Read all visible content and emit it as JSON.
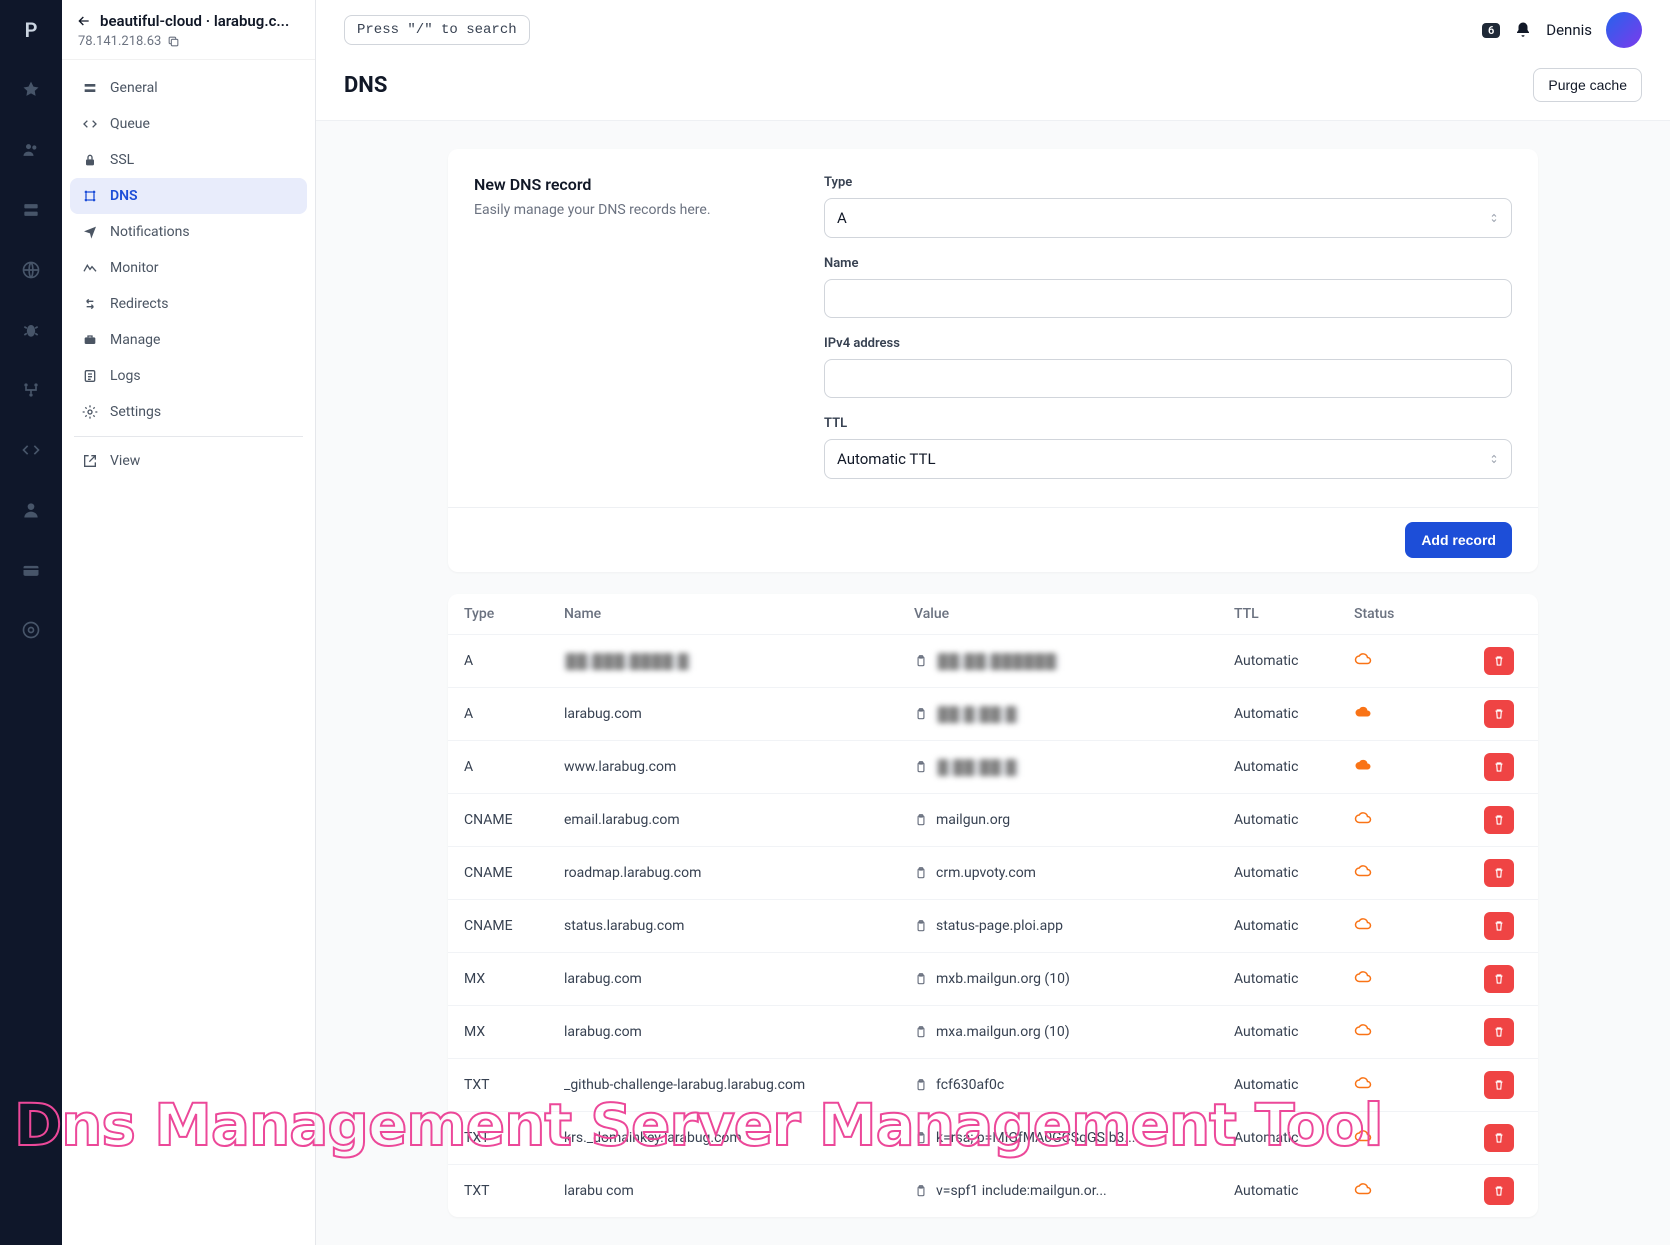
{
  "breadcrumb": "beautiful-cloud · larabug.c...",
  "server_ip": "78.141.218.63",
  "search_hint": "Press \"/\" to search",
  "notifications_count": "6",
  "username": "Dennis",
  "page_title": "DNS",
  "purge_cache": "Purge cache",
  "nav": [
    "General",
    "Queue",
    "SSL",
    "DNS",
    "Notifications",
    "Monitor",
    "Redirects",
    "Manage",
    "Logs",
    "Settings",
    "View"
  ],
  "form": {
    "title": "New DNS record",
    "subtitle": "Easily manage your DNS records here.",
    "labels": {
      "type": "Type",
      "name": "Name",
      "ipv4": "IPv4 address",
      "ttl": "TTL"
    },
    "type_value": "A",
    "ttl_value": "Automatic TTL",
    "submit": "Add record"
  },
  "table": {
    "headers": {
      "type": "Type",
      "name": "Name",
      "value": "Value",
      "ttl": "TTL",
      "status": "Status"
    },
    "rows": [
      {
        "type": "A",
        "name": "██.███.████ █",
        "name_blur": true,
        "value": "██.██.██████",
        "value_blur": true,
        "ttl": "Automatic",
        "cloud": "outline"
      },
      {
        "type": "A",
        "name": "larabug.com",
        "value": "██ █  ██  █",
        "value_blur": true,
        "ttl": "Automatic",
        "cloud": "filled"
      },
      {
        "type": "A",
        "name": "www.larabug.com",
        "value": "█  ██  ██ █",
        "value_blur": true,
        "ttl": "Automatic",
        "cloud": "filled"
      },
      {
        "type": "CNAME",
        "name": "email.larabug.com",
        "value": "mailgun.org",
        "ttl": "Automatic",
        "cloud": "outline"
      },
      {
        "type": "CNAME",
        "name": "roadmap.larabug.com",
        "value": "crm.upvoty.com",
        "ttl": "Automatic",
        "cloud": "outline"
      },
      {
        "type": "CNAME",
        "name": "status.larabug.com",
        "value": "status-page.ploi.app",
        "ttl": "Automatic",
        "cloud": "outline"
      },
      {
        "type": "MX",
        "name": "larabug.com",
        "value": "mxb.mailgun.org (10)",
        "ttl": "Automatic",
        "cloud": "outline"
      },
      {
        "type": "MX",
        "name": "larabug.com",
        "value": "mxa.mailgun.org (10)",
        "ttl": "Automatic",
        "cloud": "outline"
      },
      {
        "type": "TXT",
        "name": "_github-challenge-larabug.larabug.com",
        "value": "fcf630af0c",
        "ttl": "Automatic",
        "cloud": "outline"
      },
      {
        "type": "TXT",
        "name": "krs._domainkey.larabug.com",
        "value": "k=rsa; p=MIGfMA0GCSqGSIb3...",
        "ttl": "Automatic",
        "cloud": "outline"
      },
      {
        "type": "TXT",
        "name": "larabu com",
        "value": "v=spf1 include:mailgun.or...",
        "ttl": "Automatic",
        "cloud": "outline"
      }
    ]
  },
  "watermark": "Dns Management Server Management Tool"
}
